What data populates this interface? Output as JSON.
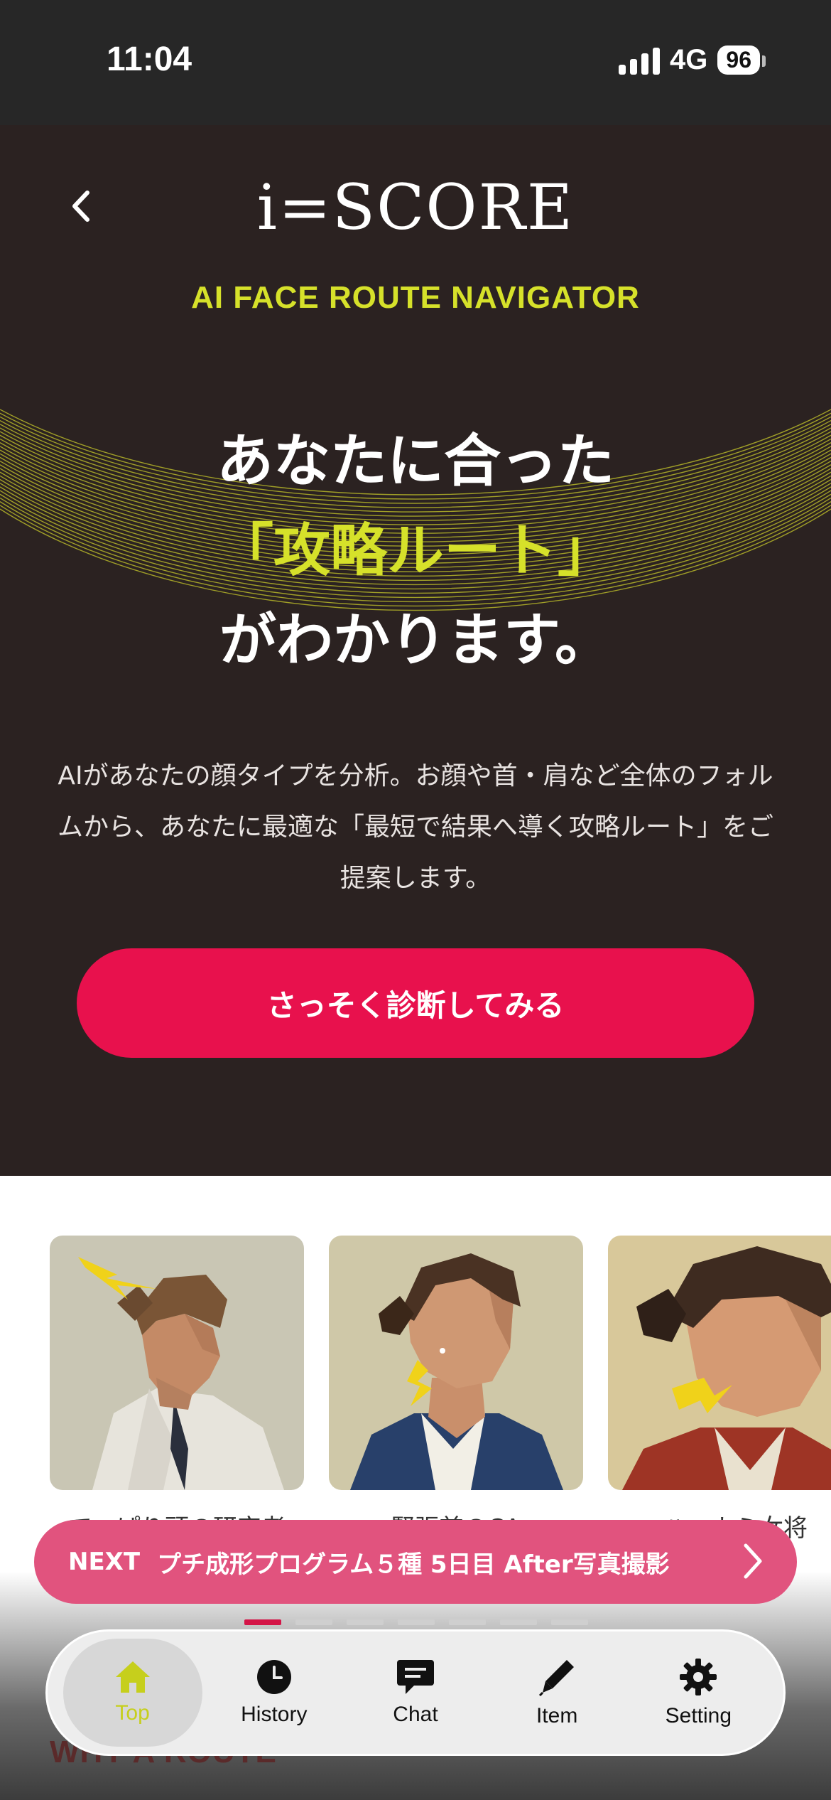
{
  "status": {
    "time": "11:04",
    "network": "4G",
    "battery": "96"
  },
  "header": {
    "logo": "i=SCORE",
    "tagline": "AI FACE ROUTE NAVIGATOR"
  },
  "hero": {
    "line1": "あなたに合った",
    "line2": "「攻略ルート」",
    "line3": "がわかります。",
    "description": "AIがあなたの顔タイプを分析。お顔や首・肩など全体のフォルムから、あなたに最適な「最短で結果へ導く攻略ルート」をご提案します。",
    "cta": "さっそく診断してみる"
  },
  "carousel": {
    "items": [
      {
        "caption": "でっぱり頭の研究者"
      },
      {
        "caption": "緊張首のCA"
      },
      {
        "caption": "ハニカミ女将"
      }
    ],
    "dot_count": 7,
    "active_dot": 0
  },
  "next_banner": {
    "label": "NEXT",
    "text": "プチ成形プログラム５種 5日目 After写真撮影"
  },
  "section_peek": "WHY A ROUTE",
  "tabbar": {
    "items": [
      {
        "label": "Top",
        "icon": "home-icon",
        "active": true
      },
      {
        "label": "History",
        "icon": "clock-icon",
        "active": false
      },
      {
        "label": "Chat",
        "icon": "chat-icon",
        "active": false
      },
      {
        "label": "Item",
        "icon": "pen-icon",
        "active": false
      },
      {
        "label": "Setting",
        "icon": "gear-icon",
        "active": false
      }
    ]
  },
  "colors": {
    "accent_yellow": "#d6e12a",
    "cta_red": "#e8114d",
    "hero_bg": "#2b2221",
    "banner_pink": "#e1537e"
  }
}
